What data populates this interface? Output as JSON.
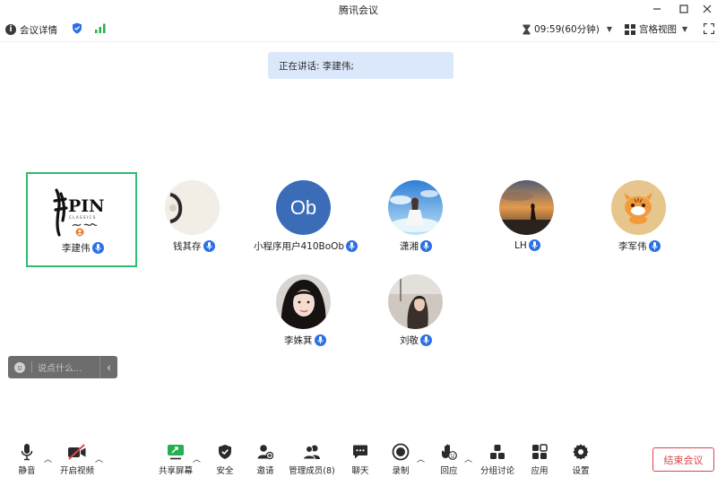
{
  "window": {
    "title": "腾讯会议"
  },
  "infobar": {
    "details_label": "会议详情",
    "timer": "09:59(60分钟)",
    "view_label": "宫格视图"
  },
  "banner": {
    "text": "正在讲话: 李建伟;"
  },
  "participants": [
    {
      "name": "李建伟",
      "avatar_text": "PIN",
      "avatar_subtext": "CLASSICS",
      "speaking": true
    },
    {
      "name": "钱其存"
    },
    {
      "name": "小程序用户410BoOb",
      "avatar_text": "Ob"
    },
    {
      "name": "潇湘"
    },
    {
      "name": "LH"
    },
    {
      "name": "李军伟"
    },
    {
      "name": "李姝萁"
    },
    {
      "name": "刘敬"
    }
  ],
  "chat": {
    "placeholder": "说点什么..."
  },
  "toolbar": {
    "mute": "静音",
    "video": "开启视频",
    "share": "共享屏幕",
    "security": "安全",
    "invite": "邀请",
    "members": "管理成员(8)",
    "chat": "聊天",
    "record": "录制",
    "react": "回应",
    "breakout": "分组讨论",
    "apps": "应用",
    "settings": "设置",
    "end": "结束会议"
  },
  "colors": {
    "accent": "#2b6fe6",
    "active_border": "#2dbd6e",
    "end_red": "#e0434d",
    "signal_green": "#22b14c",
    "banner_bg": "#dbe8fb"
  }
}
